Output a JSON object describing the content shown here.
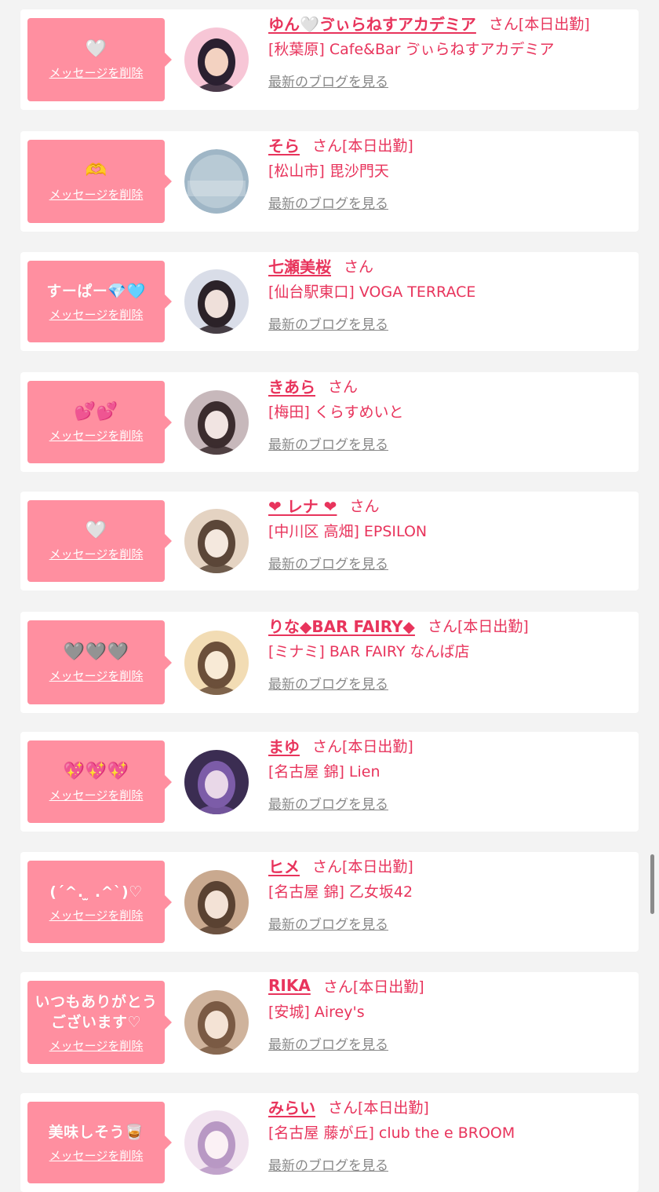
{
  "colors": {
    "accent": "#e8345c",
    "bubble": "#ff8fa0",
    "muted": "#888888",
    "background": "#f3f3f3"
  },
  "labels": {
    "delete": "メッセージを削除",
    "blog": "最新のブログを見る",
    "san": "さん"
  },
  "entries": [
    {
      "message": "🤍",
      "name": "ゆん🤍ゔぃらねすアカデミア",
      "today": "[本日出勤]",
      "shop": "[秋葉原] Cafe&Bar ゔぃらねすアカデミア"
    },
    {
      "message": "🫶",
      "name": "そら",
      "today": "[本日出勤]",
      "shop": "[松山市] 毘沙門天"
    },
    {
      "message": "すーぱー💎🩵",
      "name": "七瀬美桜",
      "today": "",
      "shop": "[仙台駅東口] VOGA TERRACE"
    },
    {
      "message": "💕💕",
      "name": "きあら",
      "today": "",
      "shop": "[梅田] くらすめいと"
    },
    {
      "message": "🤍",
      "name": "❤︎ レナ ❤︎",
      "today": "",
      "shop": "[中川区 高畑] EPSILON"
    },
    {
      "message": "🩶🩶🩶",
      "name": "りな◆BAR FAIRY◆",
      "today": "[本日出勤]",
      "shop": "[ミナミ] BAR FAIRY なんば店"
    },
    {
      "message": "💖💖💖",
      "name": "まゆ",
      "today": "[本日出勤]",
      "shop": "[名古屋 錦] Lien"
    },
    {
      "message": "(ˊ^. ̫ .^ˋ)♡",
      "name": "ヒメ",
      "today": "[本日出勤]",
      "shop": "[名古屋 錦] 乙女坂42"
    },
    {
      "message": "いつもありがとうございます♡",
      "name": "RIKA",
      "today": "[本日出勤]",
      "shop": "[安城] Airey's"
    },
    {
      "message": "美味しそう🥃",
      "name": "みらい",
      "today": "[本日出勤]",
      "shop": "[名古屋 藤が丘] club the e BROOM"
    }
  ]
}
